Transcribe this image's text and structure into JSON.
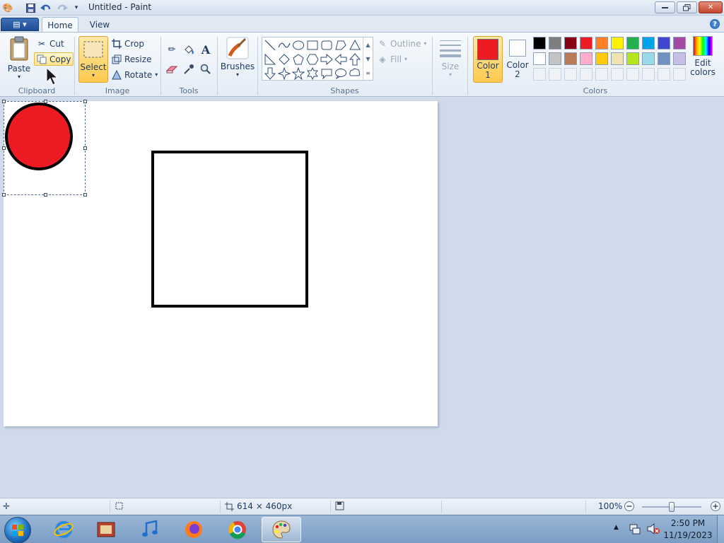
{
  "window": {
    "title": "Untitled - Paint"
  },
  "tabs": [
    {
      "label": "Home"
    },
    {
      "label": "View"
    }
  ],
  "clipboard": {
    "paste": "Paste",
    "cut": "Cut",
    "copy": "Copy",
    "group": "Clipboard"
  },
  "image": {
    "select": "Select",
    "crop": "Crop",
    "resize": "Resize",
    "rotate": "Rotate",
    "group": "Image"
  },
  "tools": {
    "group": "Tools"
  },
  "brushes": {
    "label": "Brushes"
  },
  "shapes": {
    "group": "Shapes",
    "outline": "Outline",
    "fill": "Fill"
  },
  "size": {
    "label": "Size"
  },
  "colors": {
    "color1_label": "Color 1",
    "color2_label": "Color 2",
    "color1": "#ed1c24",
    "color2": "#ffffff",
    "edit_label": "Edit colors",
    "group": "Colors",
    "row1": [
      "#000000",
      "#7f7f7f",
      "#880015",
      "#ed1c24",
      "#ff7f27",
      "#fff200",
      "#22b14c",
      "#00a2e8",
      "#3f48cc",
      "#a349a4"
    ],
    "row2": [
      "#ffffff",
      "#c3c3c3",
      "#b97a57",
      "#ffaec9",
      "#ffc90e",
      "#efe4b0",
      "#b5e61d",
      "#99d9ea",
      "#7092be",
      "#c8bfe7"
    ]
  },
  "status": {
    "canvas_size": "614 × 460px",
    "zoom": "100%"
  },
  "taskbar": {
    "time": "2:50 PM",
    "date": "11/19/2023"
  }
}
